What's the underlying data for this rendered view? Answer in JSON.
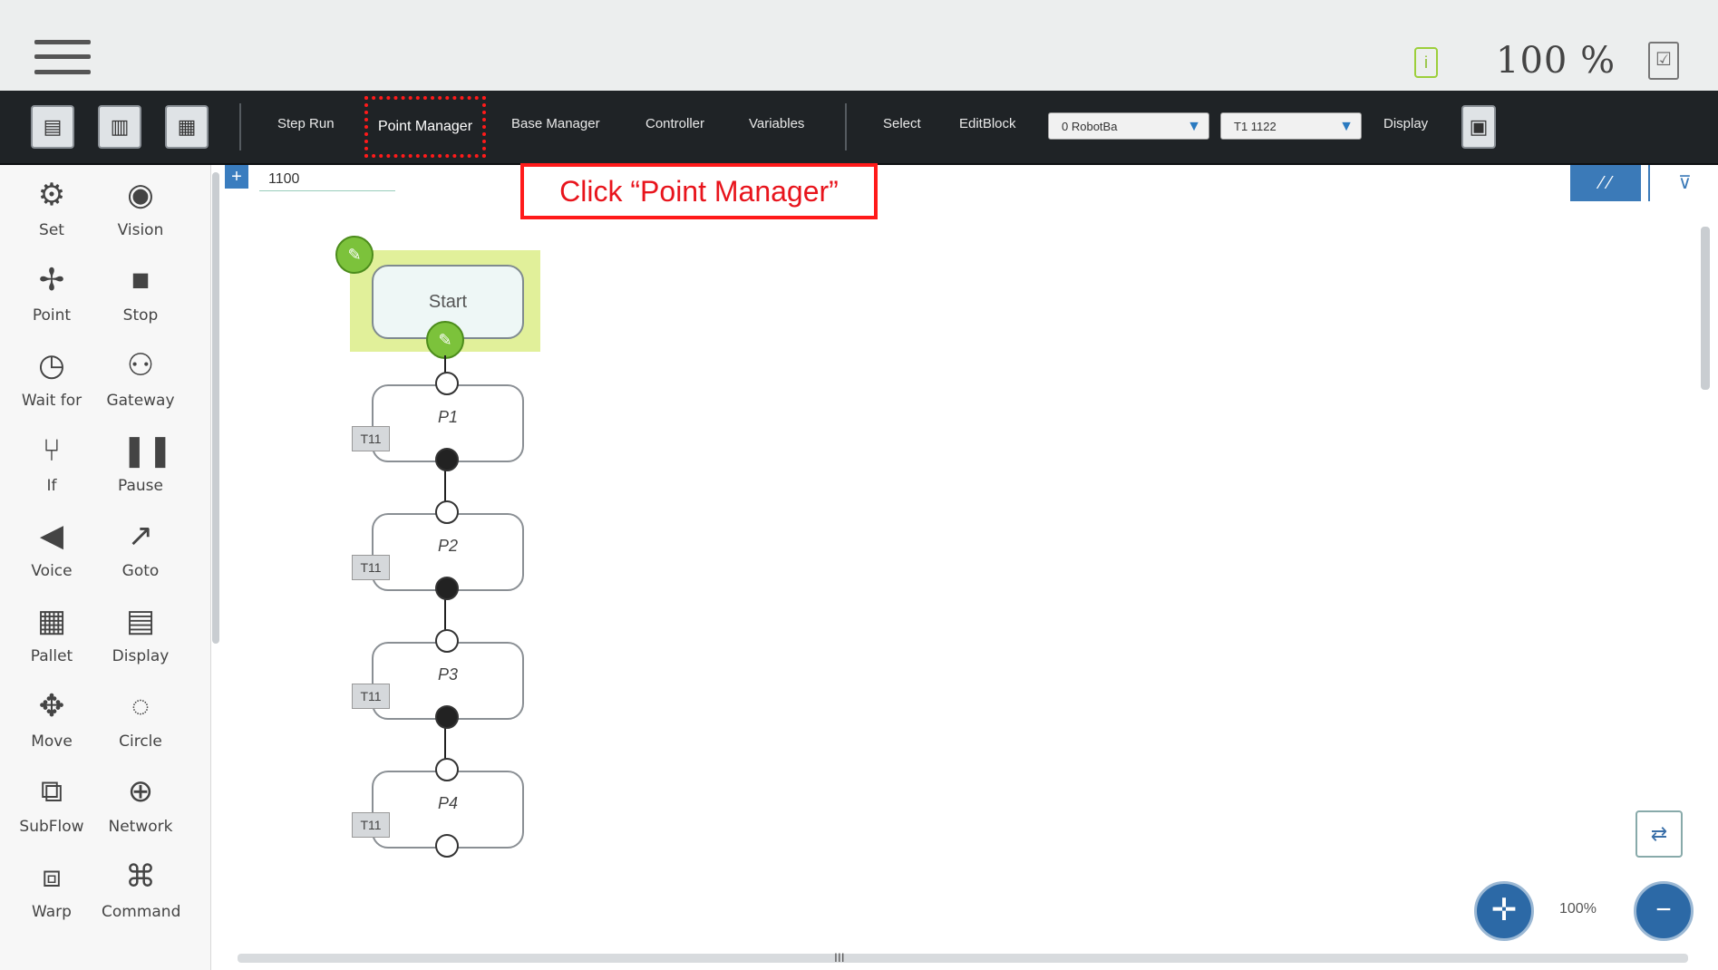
{
  "header": {
    "status_icon": "info-icon",
    "zoom_readout": "100 %",
    "doc_icon": "checklist-icon"
  },
  "toolbar": {
    "icons": [
      "flow-icon",
      "save-icon",
      "save-as-icon"
    ],
    "tabs": [
      {
        "label": "Step Run"
      },
      {
        "label": "Point Manager"
      },
      {
        "label": "Base Manager"
      },
      {
        "label": "Controller"
      },
      {
        "label": "Variables"
      }
    ],
    "select_label": "Select",
    "editblock_label": "EditBlock",
    "base_dropdown": "0 RobotBa",
    "tool_dropdown": "T1 1122",
    "display_label": "Display",
    "display_icon": "monitor-icon"
  },
  "hint": {
    "text": "Click “Point Manager”",
    "color": "#e8141c"
  },
  "palette": {
    "items": [
      {
        "label": "Set",
        "icon": "gear-icon"
      },
      {
        "label": "Vision",
        "icon": "camera-icon"
      },
      {
        "label": "Point",
        "icon": "point-icon"
      },
      {
        "label": "Stop",
        "icon": "stop-icon"
      },
      {
        "label": "Wait for",
        "icon": "clock-icon"
      },
      {
        "label": "Gateway",
        "icon": "gateway-icon"
      },
      {
        "label": "If",
        "icon": "branch-icon"
      },
      {
        "label": "Pause",
        "icon": "pause-icon"
      },
      {
        "label": "Voice",
        "icon": "speaker-icon"
      },
      {
        "label": "Goto",
        "icon": "goto-icon"
      },
      {
        "label": "Pallet",
        "icon": "pallet-icon"
      },
      {
        "label": "Display",
        "icon": "display-icon"
      },
      {
        "label": "Move",
        "icon": "move-icon"
      },
      {
        "label": "Circle",
        "icon": "circle-icon"
      },
      {
        "label": "SubFlow",
        "icon": "subflow-icon"
      },
      {
        "label": "Network",
        "icon": "network-icon"
      },
      {
        "label": "Warp",
        "icon": "warp-icon"
      },
      {
        "label": "Command",
        "icon": "command-icon"
      }
    ]
  },
  "canvas": {
    "field_value": "1100",
    "start_label": "Start",
    "nodes": [
      {
        "label": "P1",
        "tag": "T11"
      },
      {
        "label": "P2",
        "tag": "T11"
      },
      {
        "label": "P3",
        "tag": "T11"
      },
      {
        "label": "P4",
        "tag": "T11"
      }
    ],
    "zoom_percent": "100%",
    "scroll_mark": "III"
  },
  "colors": {
    "toolbar_bg": "#1f2326",
    "accent_blue": "#3b7ab8",
    "start_highlight": "#e1f09a",
    "green": "#7cc23b",
    "hint_red": "#ff1a1a"
  }
}
